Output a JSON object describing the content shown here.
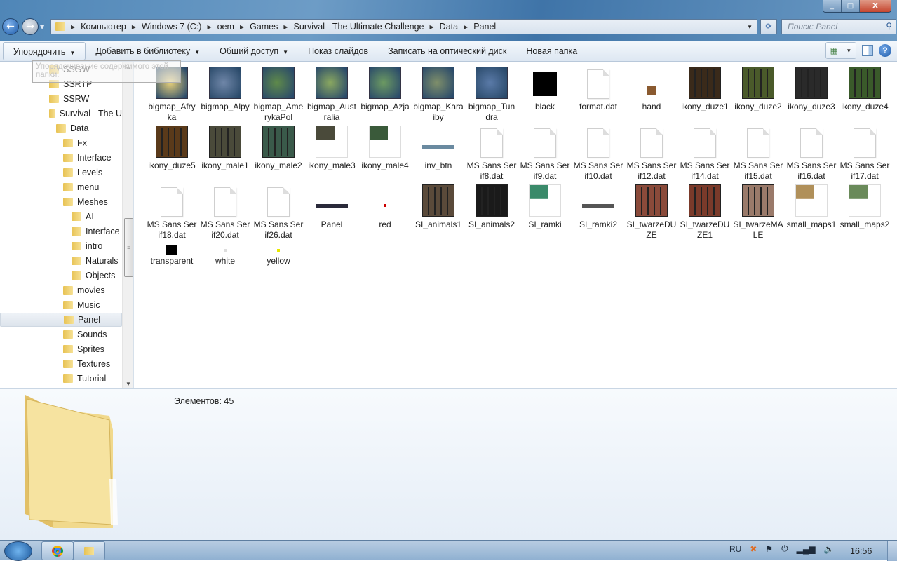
{
  "window": {
    "minimize": "_",
    "maximize": "□",
    "close": "X"
  },
  "address": {
    "crumbs": [
      "Компьютер",
      "Windows 7 (C:)",
      "oem",
      "Games",
      "Survival - The Ultimate Challenge",
      "Data",
      "Panel"
    ]
  },
  "search": {
    "placeholder": "Поиск: Panel"
  },
  "toolbar": {
    "organize": "Упорядочить",
    "add_to_library": "Добавить в библиотеку",
    "share": "Общий доступ",
    "slideshow": "Показ слайдов",
    "burn": "Записать на оптический диск",
    "new_folder": "Новая папка"
  },
  "tooltip": "Упорядочивание содержимого этой папки.",
  "tree": [
    {
      "label": "SSGW",
      "level": 0
    },
    {
      "label": "SSRTP",
      "level": 0
    },
    {
      "label": "SSRW",
      "level": 0
    },
    {
      "label": "Survival - The U",
      "level": 0
    },
    {
      "label": "Data",
      "level": 1
    },
    {
      "label": "Fx",
      "level": 2
    },
    {
      "label": "Interface",
      "level": 2
    },
    {
      "label": "Levels",
      "level": 2
    },
    {
      "label": "menu",
      "level": 2
    },
    {
      "label": "Meshes",
      "level": 2
    },
    {
      "label": "AI",
      "level": 3
    },
    {
      "label": "Interface",
      "level": 3
    },
    {
      "label": "intro",
      "level": 3
    },
    {
      "label": "Naturals",
      "level": 3
    },
    {
      "label": "Objects",
      "level": 3
    },
    {
      "label": "movies",
      "level": 2
    },
    {
      "label": "Music",
      "level": 2
    },
    {
      "label": "Panel",
      "level": 2,
      "selected": true
    },
    {
      "label": "Sounds",
      "level": 2
    },
    {
      "label": "Sprites",
      "level": 2
    },
    {
      "label": "Textures",
      "level": 2
    },
    {
      "label": "Tutorial",
      "level": 2
    }
  ],
  "files": [
    {
      "name": "bigmap_Afryka",
      "kind": "map",
      "color": "#e6cf7a"
    },
    {
      "name": "bigmap_Alpy",
      "kind": "map",
      "color": "#6f86a8"
    },
    {
      "name": "bigmap_AmerykaPol",
      "kind": "map",
      "color": "#5f8a4a"
    },
    {
      "name": "bigmap_Australia",
      "kind": "map",
      "color": "#8aa860"
    },
    {
      "name": "bigmap_Azja",
      "kind": "map",
      "color": "#6c9a62"
    },
    {
      "name": "bigmap_Karaiby",
      "kind": "map",
      "color": "#7f8f6a"
    },
    {
      "name": "bigmap_Tundra",
      "kind": "map",
      "color": "#5a7aa8"
    },
    {
      "name": "black",
      "kind": "solid",
      "color": "#000000"
    },
    {
      "name": "format.dat",
      "kind": "doc"
    },
    {
      "name": "hand",
      "kind": "tiny",
      "color": "#8a5a30"
    },
    {
      "name": "ikony_duze1",
      "kind": "sheet",
      "color": "#3a2a1a"
    },
    {
      "name": "ikony_duze2",
      "kind": "sheet",
      "color": "#4a5a2a"
    },
    {
      "name": "ikony_duze3",
      "kind": "sheet",
      "color": "#2a2a2a"
    },
    {
      "name": "ikony_duze4",
      "kind": "sheet",
      "color": "#3a5a2a"
    },
    {
      "name": "ikony_duze5",
      "kind": "sheet",
      "color": "#5a3a1a"
    },
    {
      "name": "ikony_male1",
      "kind": "sheet",
      "color": "#4a4a3a"
    },
    {
      "name": "ikony_male2",
      "kind": "sheet",
      "color": "#3a5a4a"
    },
    {
      "name": "ikony_male3",
      "kind": "partial",
      "color": "#4a4a3a"
    },
    {
      "name": "ikony_male4",
      "kind": "partial",
      "color": "#3a5a3a"
    },
    {
      "name": "inv_btn",
      "kind": "strip",
      "color": "#6a8aa0"
    },
    {
      "name": "MS Sans Serif8.dat",
      "kind": "doc"
    },
    {
      "name": "MS Sans Serif9.dat",
      "kind": "doc"
    },
    {
      "name": "MS Sans Serif10.dat",
      "kind": "doc"
    },
    {
      "name": "MS Sans Serif12.dat",
      "kind": "doc"
    },
    {
      "name": "MS Sans Serif14.dat",
      "kind": "doc"
    },
    {
      "name": "MS Sans Serif15.dat",
      "kind": "doc"
    },
    {
      "name": "MS Sans Serif16.dat",
      "kind": "doc"
    },
    {
      "name": "MS Sans Serif17.dat",
      "kind": "doc"
    },
    {
      "name": "MS Sans Serif18.dat",
      "kind": "doc"
    },
    {
      "name": "MS Sans Serif20.dat",
      "kind": "doc"
    },
    {
      "name": "MS Sans Serif26.dat",
      "kind": "doc"
    },
    {
      "name": "Panel",
      "kind": "strip",
      "color": "#2a2a3a"
    },
    {
      "name": "red",
      "kind": "dot",
      "color": "#cc0000"
    },
    {
      "name": "SI_animals1",
      "kind": "sheet",
      "color": "#5a4a3a"
    },
    {
      "name": "SI_animals2",
      "kind": "sheet",
      "color": "#1a1a1a"
    },
    {
      "name": "SI_ramki",
      "kind": "partial",
      "color": "#3a8a6a"
    },
    {
      "name": "SI_ramki2",
      "kind": "strip",
      "color": "#555555"
    },
    {
      "name": "SI_twarzeDUZE",
      "kind": "sheet",
      "color": "#8a4a3a"
    },
    {
      "name": "SI_twarzeDUZE1",
      "kind": "sheet",
      "color": "#7a3a2a"
    },
    {
      "name": "SI_twarzeMALE",
      "kind": "sheet",
      "color": "#9a7a6a"
    },
    {
      "name": "small_maps1",
      "kind": "partial",
      "color": "#b0905a"
    },
    {
      "name": "small_maps2",
      "kind": "partial",
      "color": "#6a8a5a"
    },
    {
      "name": "transparent",
      "kind": "small-solid",
      "color": "#000000"
    },
    {
      "name": "white",
      "kind": "dot",
      "color": "#dddddd"
    },
    {
      "name": "yellow",
      "kind": "dot",
      "color": "#e8e800"
    }
  ],
  "details": {
    "count": "Элементов: 45"
  },
  "taskbar": {
    "lang": "RU",
    "clock": "16:56"
  }
}
